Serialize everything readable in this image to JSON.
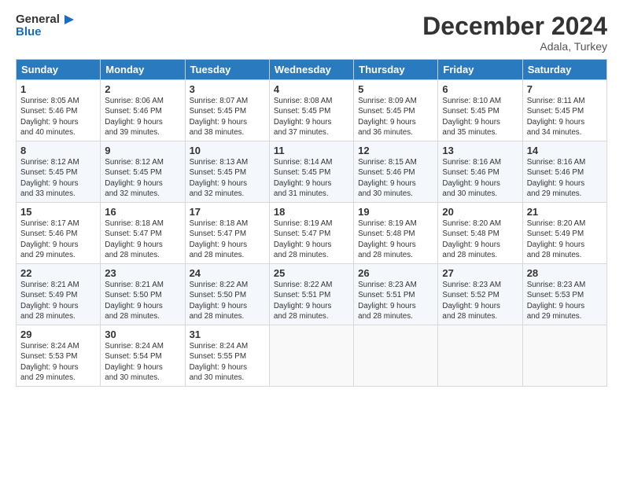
{
  "header": {
    "logo_line1": "General",
    "logo_line2": "Blue",
    "month": "December 2024",
    "location": "Adala, Turkey"
  },
  "days_of_week": [
    "Sunday",
    "Monday",
    "Tuesday",
    "Wednesday",
    "Thursday",
    "Friday",
    "Saturday"
  ],
  "weeks": [
    [
      {
        "day": "1",
        "lines": [
          "Sunrise: 8:05 AM",
          "Sunset: 5:46 PM",
          "Daylight: 9 hours",
          "and 40 minutes."
        ]
      },
      {
        "day": "2",
        "lines": [
          "Sunrise: 8:06 AM",
          "Sunset: 5:46 PM",
          "Daylight: 9 hours",
          "and 39 minutes."
        ]
      },
      {
        "day": "3",
        "lines": [
          "Sunrise: 8:07 AM",
          "Sunset: 5:45 PM",
          "Daylight: 9 hours",
          "and 38 minutes."
        ]
      },
      {
        "day": "4",
        "lines": [
          "Sunrise: 8:08 AM",
          "Sunset: 5:45 PM",
          "Daylight: 9 hours",
          "and 37 minutes."
        ]
      },
      {
        "day": "5",
        "lines": [
          "Sunrise: 8:09 AM",
          "Sunset: 5:45 PM",
          "Daylight: 9 hours",
          "and 36 minutes."
        ]
      },
      {
        "day": "6",
        "lines": [
          "Sunrise: 8:10 AM",
          "Sunset: 5:45 PM",
          "Daylight: 9 hours",
          "and 35 minutes."
        ]
      },
      {
        "day": "7",
        "lines": [
          "Sunrise: 8:11 AM",
          "Sunset: 5:45 PM",
          "Daylight: 9 hours",
          "and 34 minutes."
        ]
      }
    ],
    [
      {
        "day": "8",
        "lines": [
          "Sunrise: 8:12 AM",
          "Sunset: 5:45 PM",
          "Daylight: 9 hours",
          "and 33 minutes."
        ]
      },
      {
        "day": "9",
        "lines": [
          "Sunrise: 8:12 AM",
          "Sunset: 5:45 PM",
          "Daylight: 9 hours",
          "and 32 minutes."
        ]
      },
      {
        "day": "10",
        "lines": [
          "Sunrise: 8:13 AM",
          "Sunset: 5:45 PM",
          "Daylight: 9 hours",
          "and 32 minutes."
        ]
      },
      {
        "day": "11",
        "lines": [
          "Sunrise: 8:14 AM",
          "Sunset: 5:45 PM",
          "Daylight: 9 hours",
          "and 31 minutes."
        ]
      },
      {
        "day": "12",
        "lines": [
          "Sunrise: 8:15 AM",
          "Sunset: 5:46 PM",
          "Daylight: 9 hours",
          "and 30 minutes."
        ]
      },
      {
        "day": "13",
        "lines": [
          "Sunrise: 8:16 AM",
          "Sunset: 5:46 PM",
          "Daylight: 9 hours",
          "and 30 minutes."
        ]
      },
      {
        "day": "14",
        "lines": [
          "Sunrise: 8:16 AM",
          "Sunset: 5:46 PM",
          "Daylight: 9 hours",
          "and 29 minutes."
        ]
      }
    ],
    [
      {
        "day": "15",
        "lines": [
          "Sunrise: 8:17 AM",
          "Sunset: 5:46 PM",
          "Daylight: 9 hours",
          "and 29 minutes."
        ]
      },
      {
        "day": "16",
        "lines": [
          "Sunrise: 8:18 AM",
          "Sunset: 5:47 PM",
          "Daylight: 9 hours",
          "and 28 minutes."
        ]
      },
      {
        "day": "17",
        "lines": [
          "Sunrise: 8:18 AM",
          "Sunset: 5:47 PM",
          "Daylight: 9 hours",
          "and 28 minutes."
        ]
      },
      {
        "day": "18",
        "lines": [
          "Sunrise: 8:19 AM",
          "Sunset: 5:47 PM",
          "Daylight: 9 hours",
          "and 28 minutes."
        ]
      },
      {
        "day": "19",
        "lines": [
          "Sunrise: 8:19 AM",
          "Sunset: 5:48 PM",
          "Daylight: 9 hours",
          "and 28 minutes."
        ]
      },
      {
        "day": "20",
        "lines": [
          "Sunrise: 8:20 AM",
          "Sunset: 5:48 PM",
          "Daylight: 9 hours",
          "and 28 minutes."
        ]
      },
      {
        "day": "21",
        "lines": [
          "Sunrise: 8:20 AM",
          "Sunset: 5:49 PM",
          "Daylight: 9 hours",
          "and 28 minutes."
        ]
      }
    ],
    [
      {
        "day": "22",
        "lines": [
          "Sunrise: 8:21 AM",
          "Sunset: 5:49 PM",
          "Daylight: 9 hours",
          "and 28 minutes."
        ]
      },
      {
        "day": "23",
        "lines": [
          "Sunrise: 8:21 AM",
          "Sunset: 5:50 PM",
          "Daylight: 9 hours",
          "and 28 minutes."
        ]
      },
      {
        "day": "24",
        "lines": [
          "Sunrise: 8:22 AM",
          "Sunset: 5:50 PM",
          "Daylight: 9 hours",
          "and 28 minutes."
        ]
      },
      {
        "day": "25",
        "lines": [
          "Sunrise: 8:22 AM",
          "Sunset: 5:51 PM",
          "Daylight: 9 hours",
          "and 28 minutes."
        ]
      },
      {
        "day": "26",
        "lines": [
          "Sunrise: 8:23 AM",
          "Sunset: 5:51 PM",
          "Daylight: 9 hours",
          "and 28 minutes."
        ]
      },
      {
        "day": "27",
        "lines": [
          "Sunrise: 8:23 AM",
          "Sunset: 5:52 PM",
          "Daylight: 9 hours",
          "and 28 minutes."
        ]
      },
      {
        "day": "28",
        "lines": [
          "Sunrise: 8:23 AM",
          "Sunset: 5:53 PM",
          "Daylight: 9 hours",
          "and 29 minutes."
        ]
      }
    ],
    [
      {
        "day": "29",
        "lines": [
          "Sunrise: 8:24 AM",
          "Sunset: 5:53 PM",
          "Daylight: 9 hours",
          "and 29 minutes."
        ]
      },
      {
        "day": "30",
        "lines": [
          "Sunrise: 8:24 AM",
          "Sunset: 5:54 PM",
          "Daylight: 9 hours",
          "and 30 minutes."
        ]
      },
      {
        "day": "31",
        "lines": [
          "Sunrise: 8:24 AM",
          "Sunset: 5:55 PM",
          "Daylight: 9 hours",
          "and 30 minutes."
        ]
      },
      null,
      null,
      null,
      null
    ]
  ]
}
